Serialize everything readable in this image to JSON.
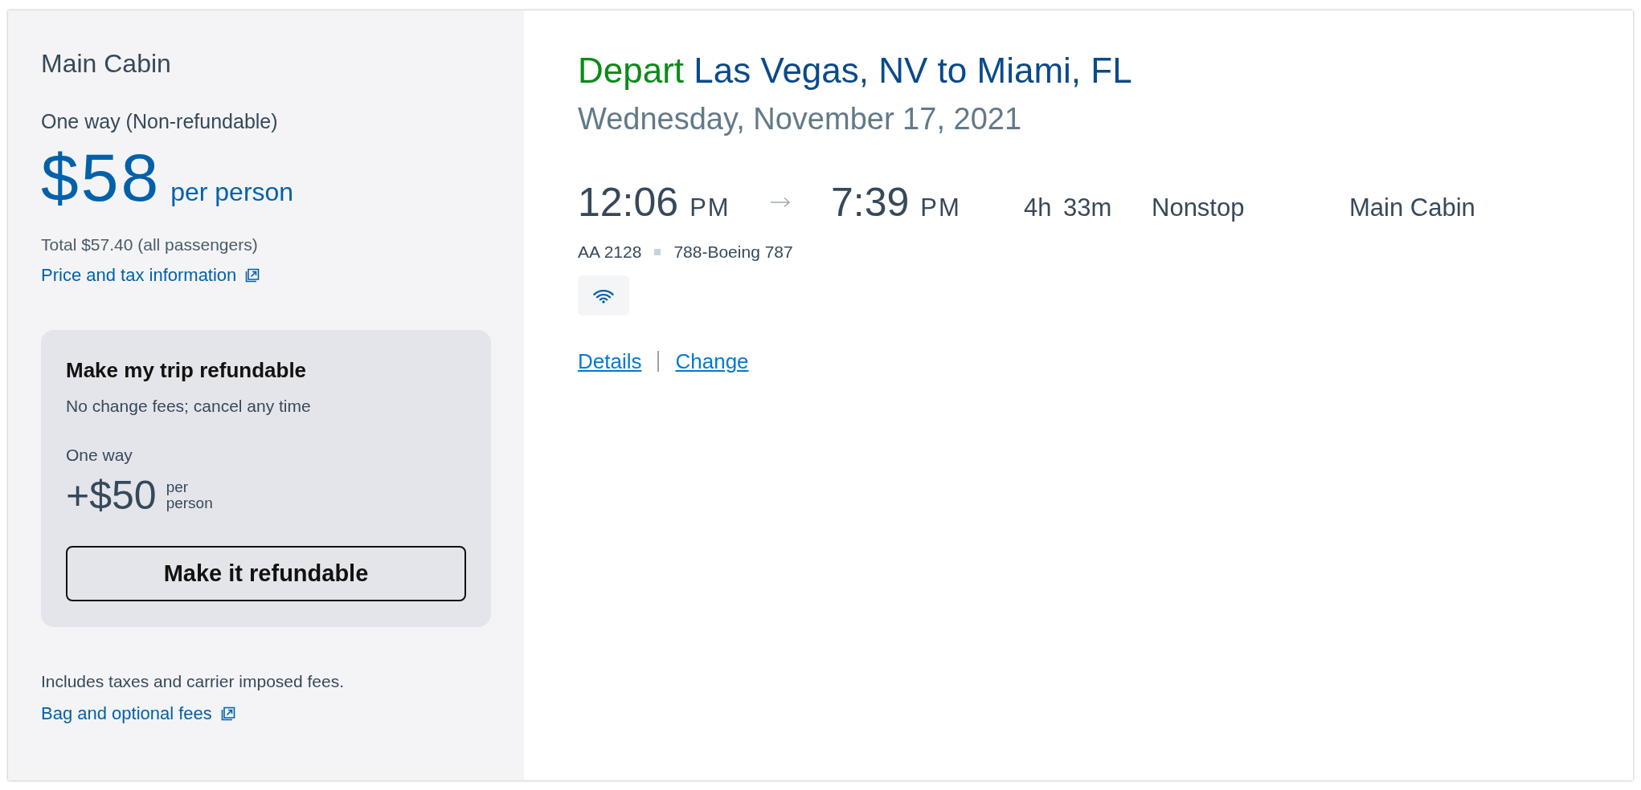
{
  "fare_panel": {
    "cabin": "Main Cabin",
    "trip_type": "One way (Non-refundable)",
    "price": "$58",
    "price_unit": "per person",
    "total": "Total $57.40 (all passengers)",
    "price_link": "Price and tax information",
    "refund_offer": {
      "title": "Make my trip refundable",
      "subtitle": "No change fees; cancel any time",
      "trip_type": "One way",
      "price": "+$50",
      "price_unit": "per person",
      "button": "Make it refundable"
    },
    "fees_note": "Includes taxes and carrier imposed fees.",
    "fees_link": "Bag and optional fees"
  },
  "flight": {
    "direction": "Depart",
    "route": "Las Vegas, NV to Miami, FL",
    "date": "Wednesday, November 17, 2021",
    "departure_time": "12:06",
    "departure_period": "PM",
    "arrival_time": "7:39",
    "arrival_period": "PM",
    "duration": "4h 33m",
    "stops": "Nonstop",
    "cabin": "Main Cabin",
    "flight_number": "AA 2128",
    "aircraft": "788-Boeing 787",
    "links": [
      "Details",
      "Change"
    ]
  }
}
